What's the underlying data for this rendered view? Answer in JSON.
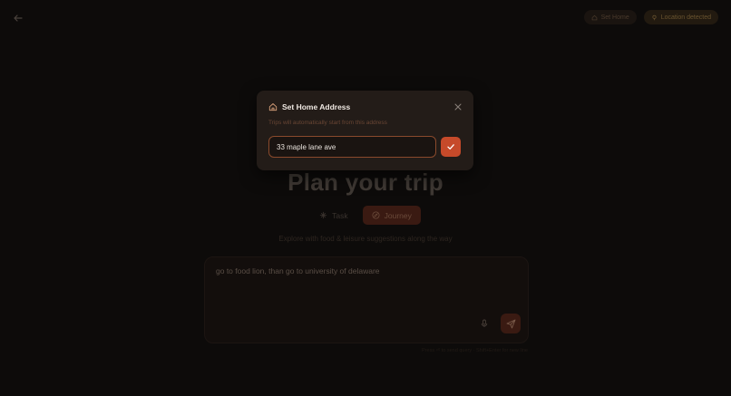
{
  "header": {
    "back_icon": "arrow-left-icon",
    "set_home_label": "Set Home",
    "location_label": "Location detected"
  },
  "main": {
    "title": "Plan your trip",
    "modes": [
      {
        "label": "Task",
        "icon": "sparkle-icon",
        "active": false
      },
      {
        "label": "Journey",
        "icon": "compass-icon",
        "active": true
      }
    ],
    "hint": "Explore with food & leisure suggestions along the way",
    "compose_text": "go to food lion, than go to university of delaware",
    "footer_note": "Press ⏎ to send query · Shift+Enter for new line"
  },
  "modal": {
    "title": "Set Home Address",
    "subtitle": "Trips will automatically start from this address",
    "input_value": "33 maple lane ave"
  },
  "colors": {
    "accent": "#c64a2a",
    "background": "#0d0b0a",
    "modal_bg": "#231c18"
  }
}
